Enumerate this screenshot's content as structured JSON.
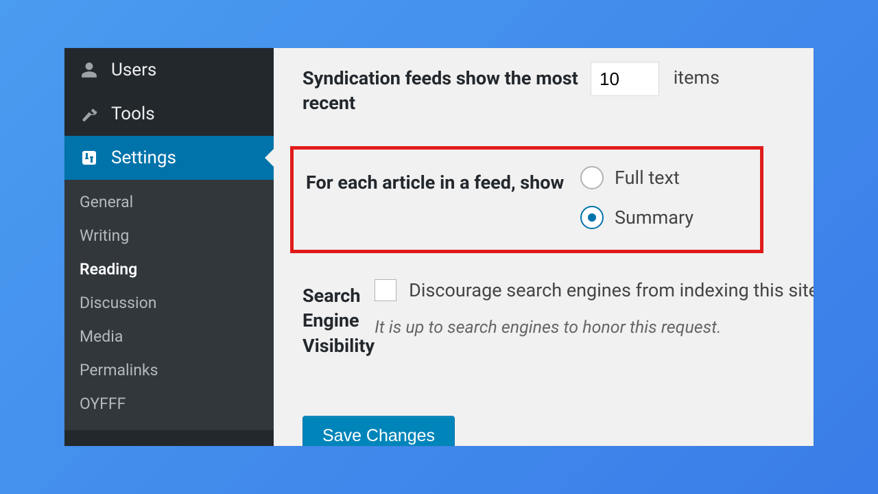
{
  "sidebar": {
    "top_items": [
      {
        "label": "Users",
        "icon": "user"
      },
      {
        "label": "Tools",
        "icon": "wrench"
      },
      {
        "label": "Settings",
        "icon": "sliders",
        "active": true
      }
    ],
    "sub_items": [
      {
        "label": "General"
      },
      {
        "label": "Writing"
      },
      {
        "label": "Reading",
        "current": true
      },
      {
        "label": "Discussion"
      },
      {
        "label": "Media"
      },
      {
        "label": "Permalinks"
      },
      {
        "label": "OYFFF"
      }
    ]
  },
  "settings": {
    "syndication": {
      "label": "Syndication feeds show the most recent",
      "value": "10",
      "suffix": "items"
    },
    "feed_show": {
      "label": "For each article in a feed, show",
      "options": {
        "full": "Full text",
        "summary": "Summary"
      },
      "selected": "summary"
    },
    "sev": {
      "label": "Search Engine Visibility",
      "checkbox_label": "Discourage search engines from indexing this site",
      "hint": "It is up to search engines to honor this request."
    },
    "save_label": "Save Changes"
  }
}
